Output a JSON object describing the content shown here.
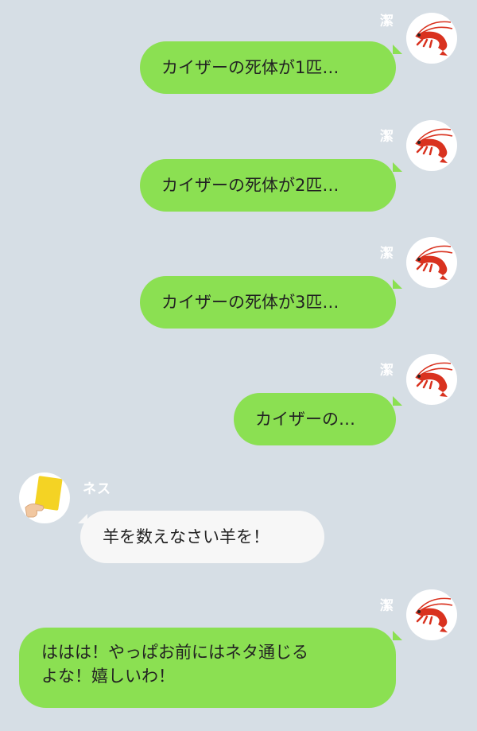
{
  "colors": {
    "background": "#d6dee5",
    "outgoing_bubble": "#8be052",
    "incoming_bubble": "#f7f7f7",
    "name_text": "#ffffff"
  },
  "messages": [
    {
      "sender": "潔",
      "avatar_icon": "shrimp-icon",
      "direction": "outgoing",
      "text": "カイザーの死体が1匹…"
    },
    {
      "sender": "潔",
      "avatar_icon": "shrimp-icon",
      "direction": "outgoing",
      "text": "カイザーの死体が2匹…"
    },
    {
      "sender": "潔",
      "avatar_icon": "shrimp-icon",
      "direction": "outgoing",
      "text": "カイザーの死体が3匹…"
    },
    {
      "sender": "潔",
      "avatar_icon": "shrimp-icon",
      "direction": "outgoing",
      "text": "カイザーの…"
    },
    {
      "sender": "ネス",
      "avatar_icon": "yellow-card-icon",
      "direction": "incoming",
      "text": "羊を数えなさい羊を！"
    },
    {
      "sender": "潔",
      "avatar_icon": "shrimp-icon",
      "direction": "outgoing",
      "text_lines": [
        "ははは！やっぱお前にはネタ通じる",
        "よな！嬉しいわ！"
      ]
    }
  ]
}
